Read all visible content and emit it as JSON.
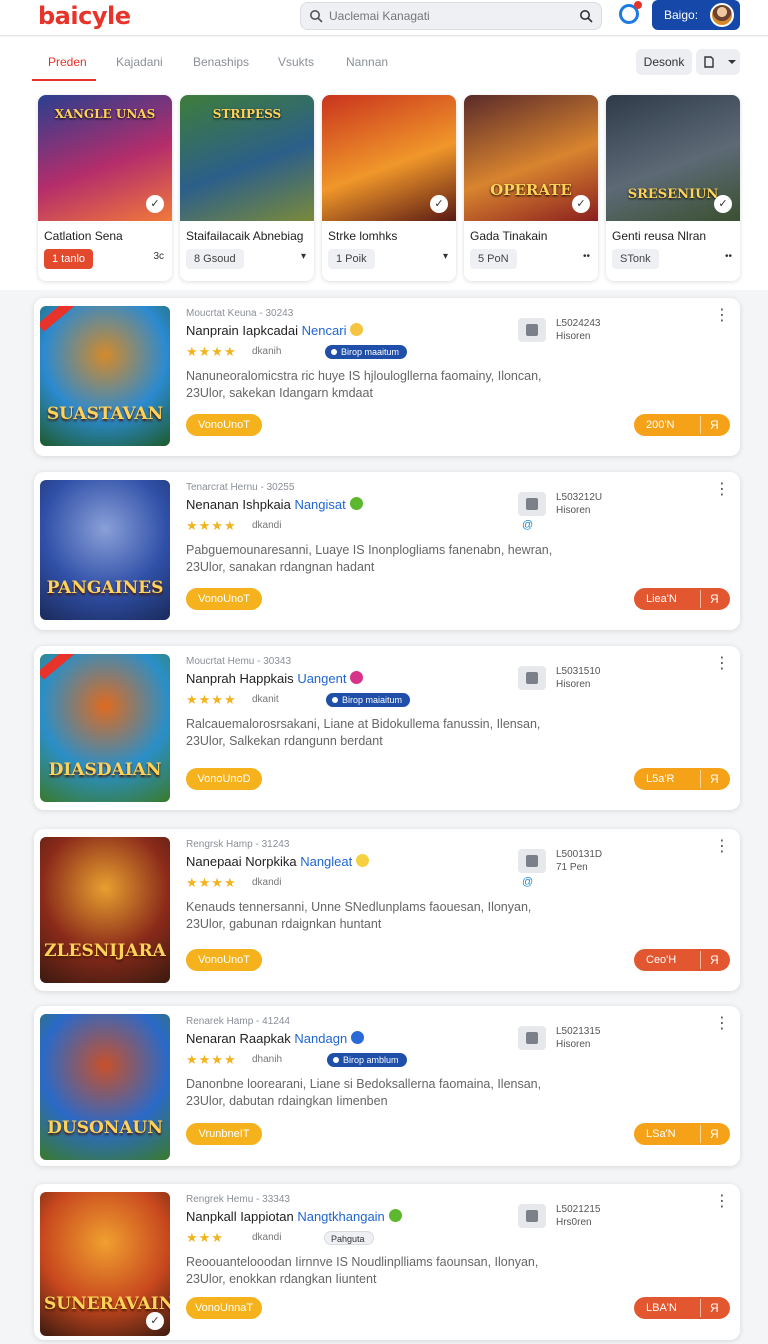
{
  "header": {
    "logo": "baicyle",
    "search_placeholder": "Uaclemai Kanagati",
    "user_label": "Baigo:"
  },
  "tabs": [
    "Preden",
    "Kajadani",
    "Benaships",
    "Vsukts",
    "Nannan"
  ],
  "sort_label": "Desonk",
  "featured": [
    {
      "cover": "XANGLE UNAS",
      "title": "Catlation Sena",
      "chip": "1 tanlo",
      "chip_style": "red",
      "extra": "3c",
      "colors": [
        "#2a3f8f",
        "#b52d6b",
        "#f07a3a"
      ]
    },
    {
      "cover": "STRIPESS",
      "title": "Staifailacaik Abnebiag",
      "chip": "8 Gsoud",
      "chip_style": "grey",
      "extra": "▾",
      "colors": [
        "#3e7d3a",
        "#2c5f8a",
        "#7a8a3a"
      ]
    },
    {
      "cover": "",
      "title": "Strke lomhks",
      "chip": "1 Poik",
      "chip_style": "grey",
      "extra": "▾",
      "colors": [
        "#c9331e",
        "#f0972a",
        "#5a1a14"
      ]
    },
    {
      "cover": "OPERATE",
      "title": "Gada Tinakain",
      "chip": "5 PoN",
      "chip_style": "grey",
      "extra": "••",
      "colors": [
        "#5a2a2a",
        "#d8842f",
        "#8a1f1f"
      ]
    },
    {
      "cover": "SRESENIUN",
      "title": "Genti reusa Nlran",
      "chip": "STonk",
      "chip_style": "grey",
      "extra": "••",
      "colors": [
        "#2e3a48",
        "#5d6a76",
        "#3a5030"
      ]
    }
  ],
  "games": [
    {
      "meta": "Moucrtat Keuna - 30243",
      "title_a": "Nanprain Iapkcadai",
      "title_b": "Nencari",
      "emo": "#f5c542",
      "stars": "★★★★",
      "stars_text": "dkanih",
      "tag": "Birop maaitum",
      "tag_style": "blue",
      "desc": "Nanuneoralomicstra ric huye IS hjloulogllerna faomainy, Iloncan, 23Ulor, sakekan Idangarn kmdaat",
      "download": "VonoUnoT",
      "side_num": "L5024243",
      "side_sub": "Hisoren",
      "side_blue": "",
      "price": "200'N",
      "price_icon": "Я",
      "price_style": "orange",
      "cover": "SUASTAVAN",
      "colors": [
        "#2b8ad0",
        "#d48a2a",
        "#1e5a2a"
      ]
    },
    {
      "meta": "Tenarcrat Hernu - 30255",
      "title_a": "Nenanan Ishpkaia",
      "title_b": "Nangisat",
      "emo": "#5cb82e",
      "stars": "★★★★",
      "stars_text": "dkandi",
      "tag": "",
      "tag_style": "none",
      "desc": "Pabguemounaresanni, Luaye IS Inonplogliams fanenabn, hewran, 23Ulor, sanakan rdangnan hadant",
      "download": "VonoUnoT",
      "side_num": "L503212U",
      "side_sub": "Hisoren",
      "side_blue": "@",
      "price": "Liea'N",
      "price_icon": "Я",
      "price_style": "red",
      "cover": "PANGAINES",
      "colors": [
        "#3050a8",
        "#8aa0d8",
        "#1a2a5a"
      ]
    },
    {
      "meta": "Moucrtat Hemu - 30343",
      "title_a": "Nanprah Happkais",
      "title_b": "Uangent",
      "emo": "#d8338a",
      "stars": "★★★★",
      "stars_text": "dkanit",
      "tag": "Birop maiaitum",
      "tag_style": "blue",
      "desc": "Ralcauemalorosrsakani, Liane at Bidokullema fanussin, Ilensan, 23Ulor, Salkekan rdangunn berdant",
      "download": "VonoUnoD",
      "side_num": "L5031510",
      "side_sub": "Hisoren",
      "side_blue": "",
      "price": "L5a'R",
      "price_icon": "Я",
      "price_style": "orange",
      "cover": "DIASDAIAN",
      "colors": [
        "#2a8fc8",
        "#e06a1e",
        "#3a7a2a"
      ]
    },
    {
      "meta": "Rengrsk Hamp - 31243",
      "title_a": "Nanepaai Norpkika",
      "title_b": "Nangleat",
      "emo": "#f5d142",
      "stars": "★★★★",
      "stars_text": "dkandi",
      "tag": "",
      "tag_style": "none",
      "desc": "Kenauds tennersanni, Unne SNedlunplams faouesan, Ilonyan, 23Ulor, gabunan rdaignkan huntant",
      "download": "VonoUnoT",
      "side_num": "L500131D",
      "side_sub": "71 Pen",
      "side_blue": "@",
      "price": "Ceo'H",
      "price_icon": "Я",
      "price_style": "red",
      "cover": "ZLESNIJARA",
      "colors": [
        "#8a2a1a",
        "#e8a030",
        "#3a1a10"
      ]
    },
    {
      "meta": "Renarek Hamp - 41244",
      "title_a": "Nenaran Raapkak",
      "title_b": "Nandagn",
      "emo": "#2a6ad8",
      "stars": "★★★★",
      "stars_text": "dhanih",
      "tag": "Birop amblum",
      "tag_style": "blue",
      "desc": "Danonbne loorearani, Liane si Bedoksallerna faomaina, Ilensan, 23Ulor, dabutan rdaingkan Iimenben",
      "download": "VrunbneIT",
      "side_num": "L5021315",
      "side_sub": "Hisoren",
      "side_blue": "",
      "price": "LSa'N",
      "price_icon": "Я",
      "price_style": "orange",
      "cover": "DUSONAUN",
      "colors": [
        "#2a6ac8",
        "#c8502a",
        "#3a7a2a"
      ]
    },
    {
      "meta": "Rengrek Hemu - 33343",
      "title_a": "Nanpkall Iappiotan",
      "title_b": "Nangtkhangain",
      "emo": "#5cb82e",
      "stars": "★★★",
      "stars_text": "dkandi",
      "tag": "Pahguta",
      "tag_style": "light",
      "desc": "Reoouantelooodan Iirnnve IS Noudlinplliams faounsan, Ilonyan, 23Ulor, enokkan rdangkan Iiuntent",
      "download": "VonoUnnaT",
      "side_num": "L5021215",
      "side_sub": "Hrs0ren",
      "side_blue": "",
      "price": "LBA'N",
      "price_icon": "Я",
      "price_style": "red",
      "cover": "SUNERAVAIN",
      "colors": [
        "#c8481e",
        "#f0a030",
        "#3a1a10"
      ]
    }
  ]
}
